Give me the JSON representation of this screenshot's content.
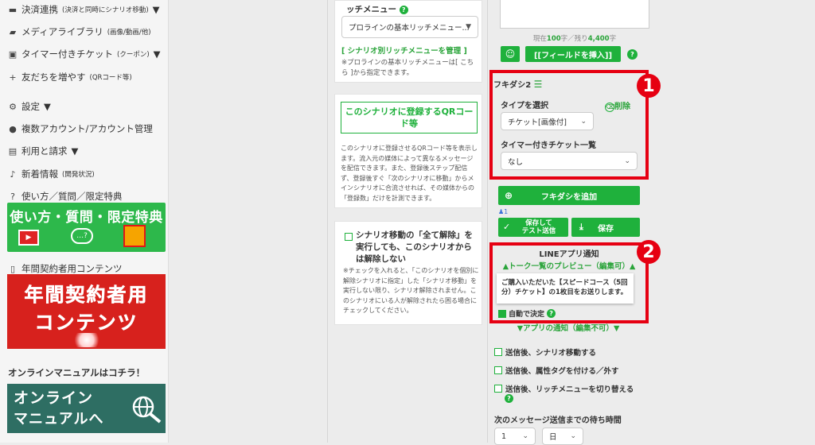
{
  "sidebar": {
    "items": [
      {
        "label": "決済連携",
        "small": "(決済と同時にシナリオ移動)",
        "caret": "▼",
        "icon": "card-icon"
      },
      {
        "label": "メディアライブラリ",
        "small": "(画像/動画/他)",
        "caret": "",
        "icon": "folder-icon"
      },
      {
        "label": "タイマー付きチケット",
        "small": "(クーポン)",
        "caret": "▼",
        "icon": "ticket-icon"
      },
      {
        "label": "友だちを増やす",
        "small": "(QRコード等)",
        "caret": "",
        "icon": "add-user-icon"
      },
      {
        "label": "設定",
        "small": "",
        "caret": "▼",
        "icon": "gear-icon"
      },
      {
        "label": "複数アカウント/アカウント管理",
        "small": "",
        "caret": "",
        "icon": "users-icon"
      },
      {
        "label": "利用と請求",
        "small": "",
        "caret": "▼",
        "icon": "billing-icon"
      },
      {
        "label": "新着情報",
        "small": "(開発状況)",
        "caret": "",
        "icon": "bell-icon"
      },
      {
        "label": "使い方／質問／限定特典",
        "small": "",
        "caret": "",
        "icon": "question-icon"
      }
    ],
    "banner_help": "使い方・質問・限定特典",
    "annual_label": "年間契約者用コンテンツ",
    "banner_annual_1": "年間契約者用",
    "banner_annual_2": "コンテンツ",
    "manual_label": "オンラインマニュアルはコチラ！",
    "banner_manual_1": "オンライン",
    "banner_manual_2": "マニュアルへ"
  },
  "rich_menu": {
    "heading": "ッチメニュー",
    "select_value": "プロラインの基本リッチメニュー...",
    "manage_link": "[ シナリオ別リッチメニューを管理 ]",
    "note": "※プロラインの基本リッチメニューは[ こちら ]から指定できます。"
  },
  "qr": {
    "button": "このシナリオに登録するQRコード等",
    "desc": "このシナリオに登録させるQRコード等を表示します。流入元の媒体によって異なるメッセージを配信できます。また、登録後ステップ配信ず、登録後すぐ「次のシナリオに移動」からメインシナリオに合流させれば、その媒体からの「登録数」だけを計測できます。"
  },
  "unlock": {
    "label": "シナリオ移動の「全て解除」を実行しても、このシナリオからは解除しない",
    "note": "※チェックを入れると、「このシナリオを個別に解除シナリオに指定」した「シナリオ移動」を実行しない限り、シナリオ解除されません。このシナリオにいる人が解除されたら困る場合にチェックしてください。"
  },
  "message": {
    "count_text_prefix": "現在",
    "count_current": "100",
    "count_mid": "字／残り",
    "count_remaining": "4,400",
    "count_suffix": "字",
    "insert_field": "[[フィールドを挿入]]"
  },
  "fukidashi": {
    "title": "フキダシ2",
    "type_label": "タイプを選択",
    "delete": "削除",
    "type_value": "チケット[画像付]",
    "ticket_label": "タイマー付きチケット一覧",
    "ticket_value": "なし",
    "add_button": "フキダシを追加",
    "user_count": "1",
    "save_test": "保存して\nテスト送信",
    "save": "保存"
  },
  "line_notice": {
    "title": "LINEアプリ通知",
    "preview_link": "▲トーク一覧のプレビュー（編集可）▲",
    "preview_text": "ご購入いただいた【スピードコース（5回分）チケット】の1枚目をお送りします。",
    "auto_label": "自動で決定",
    "app_notice_link": "▼アプリの通知（編集不可）▼"
  },
  "options": [
    "送信後、シナリオ移動する",
    "送信後、属性タグを付ける／外す",
    "送信後、リッチメニューを切り替える"
  ],
  "wait": {
    "label": "次のメッセージ送信までの待ち時間",
    "value_1": "1",
    "value_2": "日"
  },
  "annotations": {
    "badge_1": "1",
    "badge_2": "2"
  },
  "colors": {
    "accent_green": "#1fb13c",
    "annotation_red": "#e60012"
  }
}
